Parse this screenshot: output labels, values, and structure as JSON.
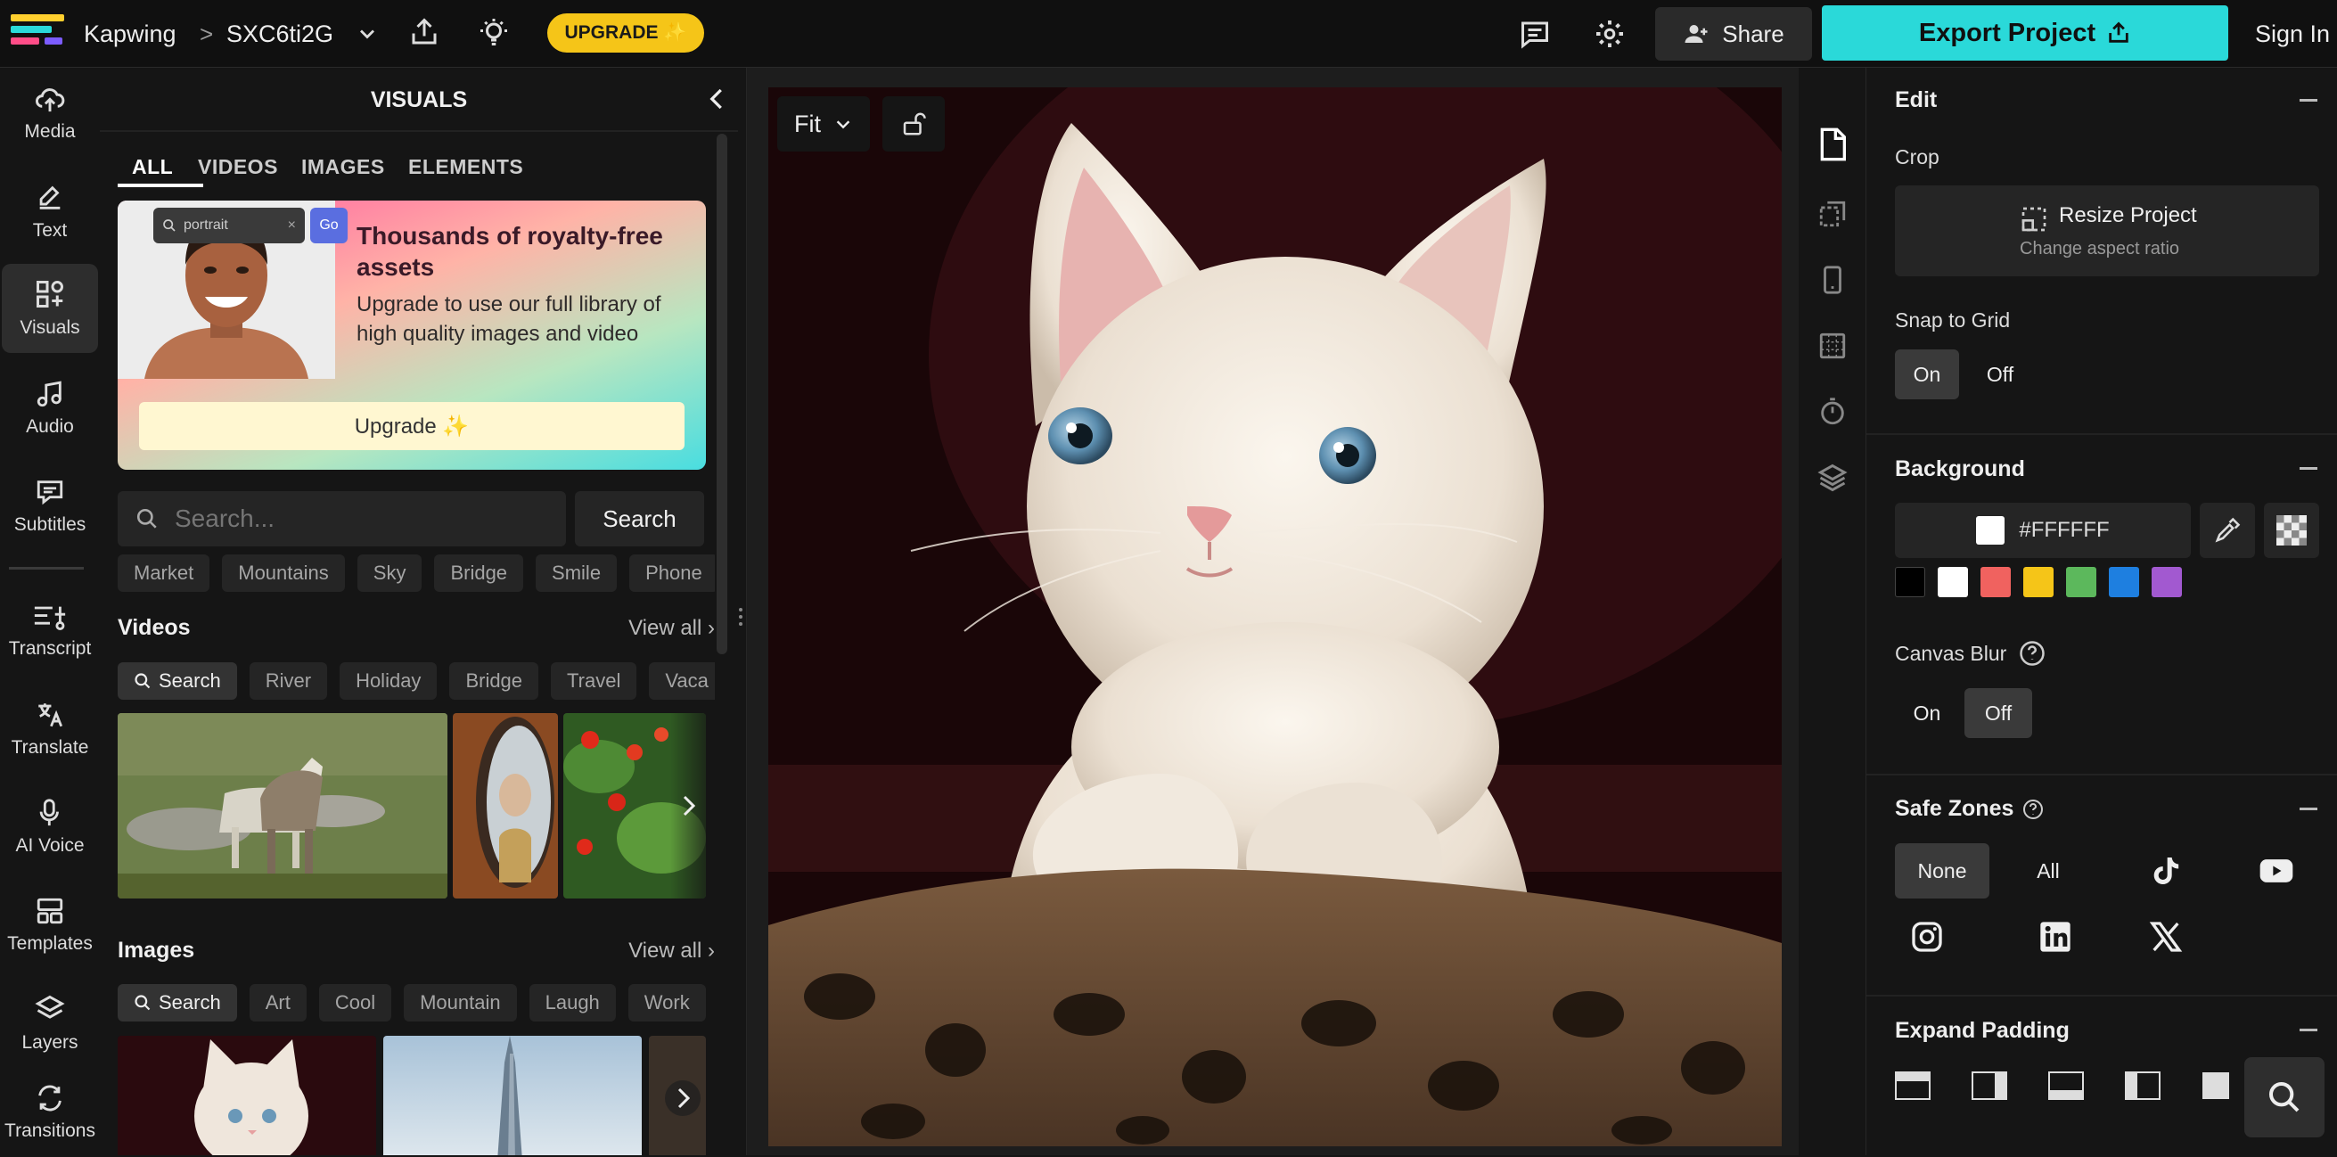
{
  "app": {
    "name": "Kapwing",
    "project": "SXC6ti2G",
    "upgrade_label": "UPGRADE ✨"
  },
  "topbar": {
    "share_label": "Share",
    "export_label": "Export Project",
    "signin_label": "Sign In"
  },
  "nav": [
    {
      "label": "Media",
      "icon": "upload-cloud-icon"
    },
    {
      "label": "Text",
      "icon": "edit-pen-icon"
    },
    {
      "label": "Visuals",
      "icon": "shapes-icon"
    },
    {
      "label": "Audio",
      "icon": "music-note-icon"
    },
    {
      "label": "Subtitles",
      "icon": "caption-icon"
    },
    {
      "label": "Transcript",
      "icon": "transcript-icon"
    },
    {
      "label": "Translate",
      "icon": "translate-icon"
    },
    {
      "label": "AI Voice",
      "icon": "microphone-icon"
    },
    {
      "label": "Templates",
      "icon": "templates-icon"
    },
    {
      "label": "Layers",
      "icon": "layers-icon"
    },
    {
      "label": "Transitions",
      "icon": "transitions-icon"
    }
  ],
  "visuals": {
    "title": "VISUALS",
    "tabs": [
      "ALL",
      "VIDEOS",
      "IMAGES",
      "ELEMENTS"
    ],
    "promo": {
      "title": "Thousands of royalty-free assets",
      "body": "Upgrade to use our full library of high quality images and video",
      "button": "Upgrade ✨",
      "mini_search_text": "portrait",
      "mini_go": "Go"
    },
    "search": {
      "placeholder": "Search...",
      "button": "Search"
    },
    "suggestions": [
      "Market",
      "Mountains",
      "Sky",
      "Bridge",
      "Smile",
      "Phone"
    ],
    "videos": {
      "title": "Videos",
      "view_all": "View all ›",
      "chips": [
        "Search",
        "River",
        "Holiday",
        "Bridge",
        "Travel",
        "Vaca"
      ]
    },
    "images": {
      "title": "Images",
      "view_all": "View all ›",
      "chips": [
        "Search",
        "Art",
        "Cool",
        "Mountain",
        "Laugh",
        "Work"
      ]
    }
  },
  "canvas": {
    "zoom_label": "Fit"
  },
  "props": {
    "edit": {
      "title": "Edit",
      "crop_label": "Crop",
      "resize_title": "Resize Project",
      "resize_sub": "Change aspect ratio"
    },
    "snap": {
      "label": "Snap to Grid",
      "on": "On",
      "off": "Off"
    },
    "background": {
      "title": "Background",
      "hex": "#FFFFFF",
      "swatches": [
        "#000000",
        "#ffffff",
        "#f0625f",
        "#f5c518",
        "#5cb85c",
        "#1e7fe0",
        "#a259d0"
      ]
    },
    "blur": {
      "label": "Canvas Blur",
      "on": "On",
      "off": "Off"
    },
    "safe": {
      "title": "Safe Zones",
      "none": "None",
      "all": "All"
    },
    "padding": {
      "title": "Expand Padding"
    }
  },
  "colors": {
    "accent": "#2ad9d9",
    "upgrade": "#f5c518",
    "panel": "#151515"
  }
}
